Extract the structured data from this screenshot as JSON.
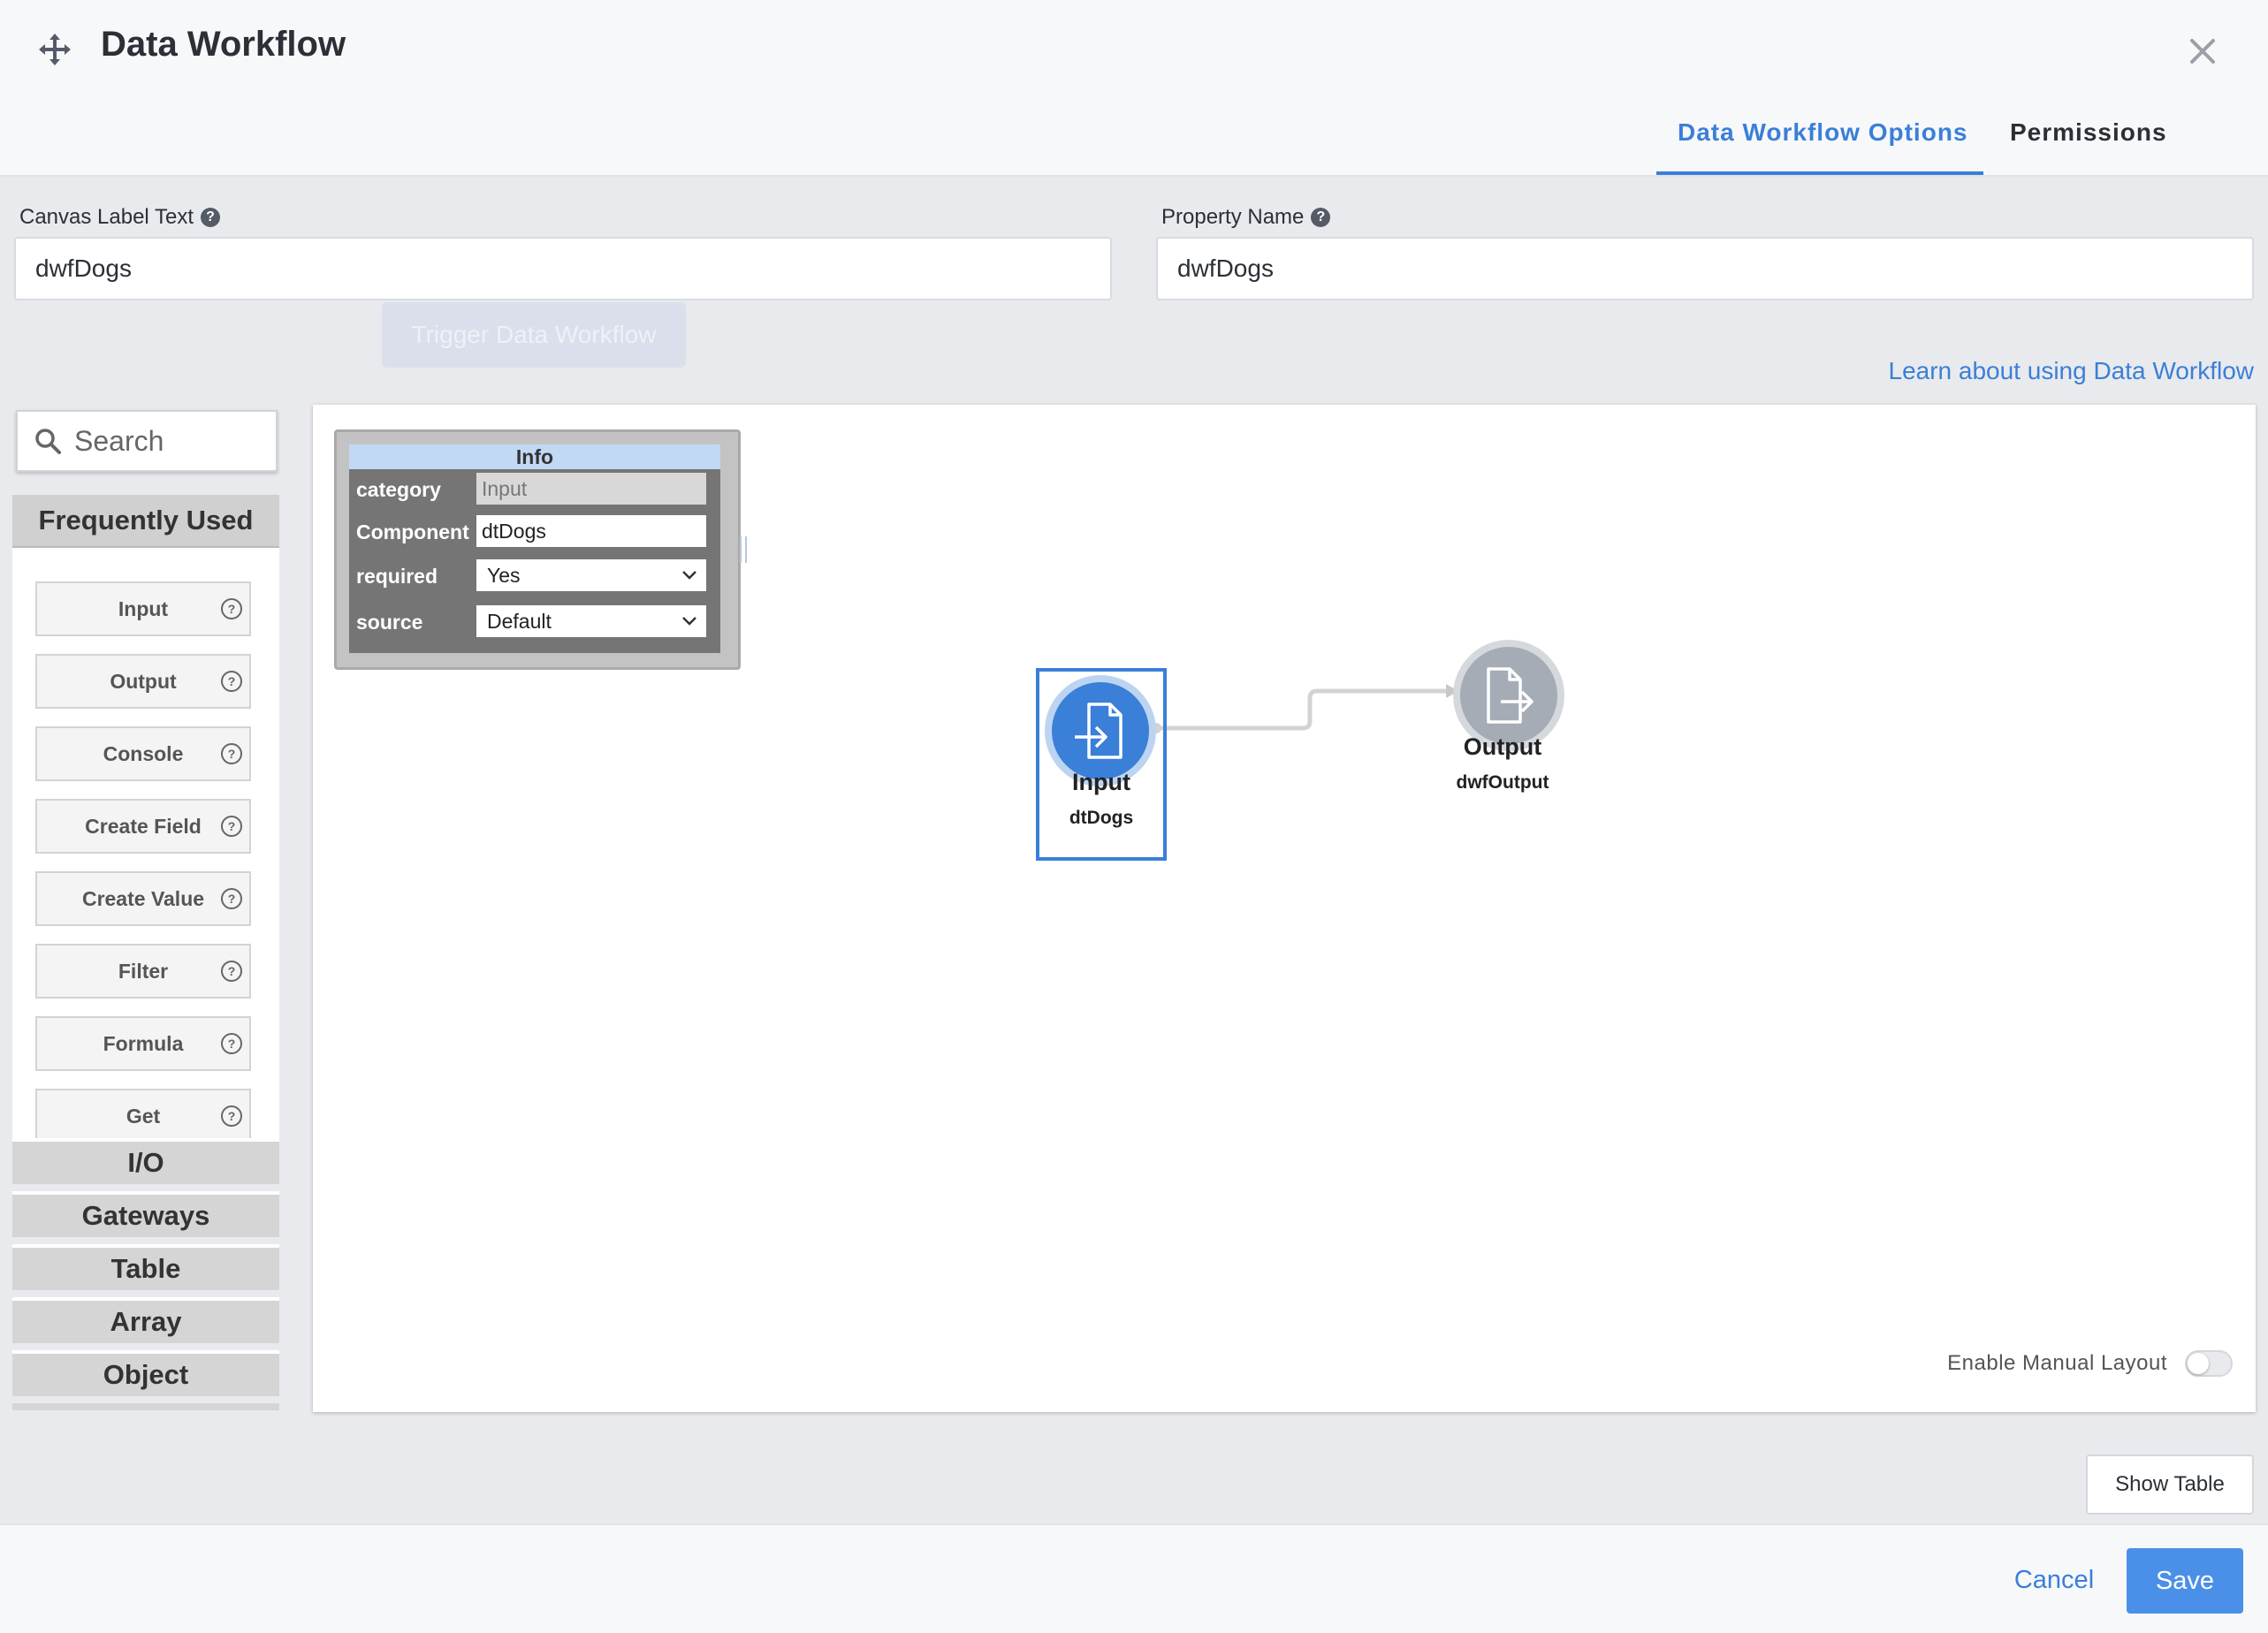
{
  "modal": {
    "title": "Data Workflow",
    "tabs": [
      {
        "label": "Data Workflow Options",
        "active": true
      },
      {
        "label": "Permissions",
        "active": false
      }
    ]
  },
  "fields": {
    "canvas_label": {
      "label": "Canvas Label Text",
      "value": "dwfDogs"
    },
    "property_name": {
      "label": "Property Name",
      "value": "dwfDogs"
    }
  },
  "learn_link": "Learn about using Data Workflow",
  "palette": {
    "search_placeholder": "Search",
    "frequently_used_header": "Frequently Used",
    "items": [
      "Input",
      "Output",
      "Console",
      "Create Field",
      "Create Value",
      "Filter",
      "Formula",
      "Get"
    ],
    "categories": [
      "I/O",
      "Gateways",
      "Table",
      "Array",
      "Object"
    ]
  },
  "info_panel": {
    "title": "Info",
    "rows": [
      {
        "key": "category",
        "value": "Input"
      },
      {
        "key": "Component",
        "value": "dtDogs"
      },
      {
        "key": "required",
        "value": "Yes"
      },
      {
        "key": "source",
        "value": "Default"
      }
    ]
  },
  "nodes": {
    "input": {
      "label": "Input",
      "sublabel": "dtDogs",
      "icon": "file-import-icon"
    },
    "output": {
      "label": "Output",
      "sublabel": "dwfOutput",
      "icon": "file-export-icon"
    }
  },
  "manual_layout_label": "Enable Manual Layout",
  "manual_layout_enabled": false,
  "buttons": {
    "show_table": "Show Table",
    "cancel": "Cancel",
    "save": "Save"
  },
  "colors": {
    "accent": "#3a7fd8",
    "save_button": "#4a90e8",
    "input_node": "#3a7fd8",
    "output_node": "#a5acb5"
  }
}
